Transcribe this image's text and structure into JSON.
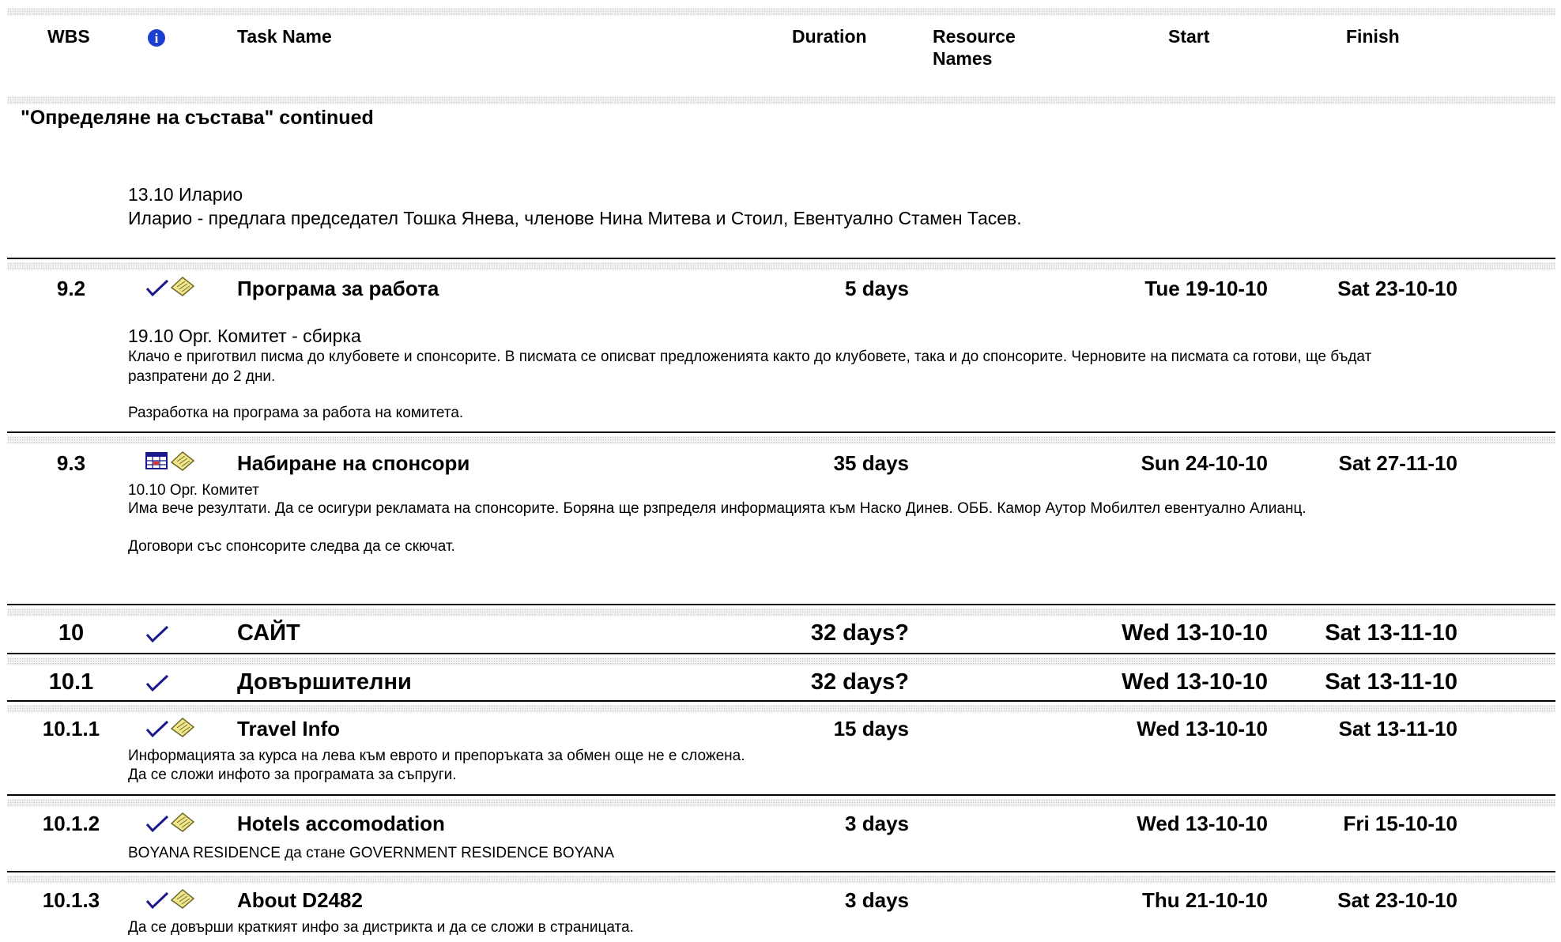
{
  "header": {
    "wbs": "WBS",
    "task_name": "Task Name",
    "duration": "Duration",
    "resource_names_line1": "Resource",
    "resource_names_line2": "Names",
    "start": "Start",
    "finish": "Finish",
    "info_icon": "info-icon"
  },
  "continued": {
    "title": "\"Определяне на състава\" continued",
    "note_line1": "13.10  Иларио",
    "note_line2": "Иларио - предлага председател Тошка Янева, членове Нина Митева и Стоил, Евентуално Стамен Тасев."
  },
  "tasks": [
    {
      "wbs": "9.2",
      "name": "Програма за работа",
      "duration": "5 days",
      "start": "Tue 19-10-10",
      "finish": "Sat 23-10-10",
      "icons": [
        "checkmark-icon",
        "note-icon"
      ],
      "note_heading": "19.10 Орг. Комитет - сбирка",
      "notes": [
        "Клачо е приготвил писма до клубовете и спонсорите. В писмата се описват предложенията както до клубовете, така и до спонсорите. Черновите на писмата са готови, ще бъдат",
        "разпратени до 2 дни.",
        "Разработка на програма за работа на комитета."
      ]
    },
    {
      "wbs": "9.3",
      "name": "Набиране на спонсори",
      "duration": "35 days",
      "start": "Sun 24-10-10",
      "finish": "Sat 27-11-10",
      "icons": [
        "calendar-icon",
        "note-icon"
      ],
      "notes": [
        "10.10 Орг. Комитет",
        "Има вече резултати. Да се осигури рекламата на спонсорите. Боряна ще рзпределя информацията към Наско Динев. ОББ. Камор Аутор Мобилтел евентуално Алианц.",
        "Договори със спонсорите следва да се скючат."
      ]
    },
    {
      "wbs": "10",
      "name": "САЙТ",
      "duration": "32 days?",
      "start": "Wed 13-10-10",
      "finish": "Sat 13-11-10",
      "icons": [
        "checkmark-icon"
      ]
    },
    {
      "wbs": "10.1",
      "name": "Довършителни",
      "duration": "32 days?",
      "start": "Wed 13-10-10",
      "finish": "Sat 13-11-10",
      "icons": [
        "checkmark-icon"
      ]
    },
    {
      "wbs": "10.1.1",
      "name": "Travel Info",
      "duration": "15 days",
      "start": "Wed 13-10-10",
      "finish": "Sat 13-11-10",
      "icons": [
        "checkmark-icon",
        "note-icon"
      ],
      "notes": [
        "Информацията за курса на лева към еврото и препоръката за обмен още не е сложена.",
        "Да се сложи инфото за програмата за съпруги."
      ]
    },
    {
      "wbs": "10.1.2",
      "name": "Hotels accomodation",
      "duration": "3 days",
      "start": "Wed 13-10-10",
      "finish": "Fri 15-10-10",
      "icons": [
        "checkmark-icon",
        "note-icon"
      ],
      "notes": [
        "BOYANA RESIDENCE  да стане GOVERNMENT RESIDENCE BOYANA"
      ]
    },
    {
      "wbs": "10.1.3",
      "name": "About D2482",
      "duration": "3 days",
      "start": "Thu 21-10-10",
      "finish": "Sat 23-10-10",
      "icons": [
        "checkmark-icon",
        "note-icon"
      ],
      "notes": [
        "Да се довърши краткият инфо за дистрикта и да се сложи в страницата."
      ]
    }
  ],
  "colors": {
    "check": "#1a1a8c",
    "info": "#1a3fd1",
    "note": "#f2e68c"
  }
}
